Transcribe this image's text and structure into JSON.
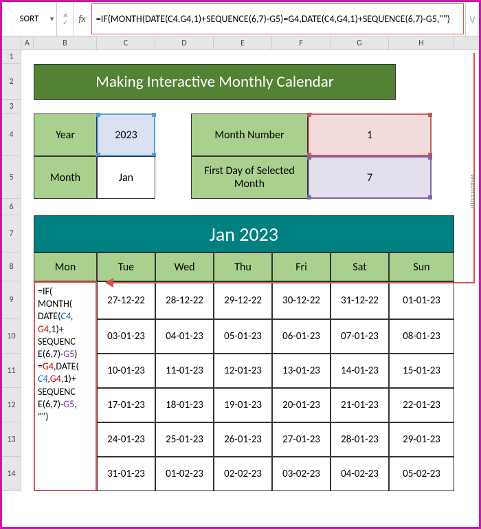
{
  "name_box": "SORT",
  "formula": "=IF(MONTH(DATE(C4,G4,1)+SEQUENCE(6,7)-G5)=G4,DATE(C4,G4,1)+SEQUENCE(6,7)-G5,\"\")",
  "columns": [
    "A",
    "B",
    "C",
    "D",
    "E",
    "F",
    "G",
    "H"
  ],
  "rows": [
    "1",
    "2",
    "3",
    "4",
    "5",
    "6",
    "7",
    "8",
    "9",
    "10",
    "11",
    "12",
    "13",
    "14"
  ],
  "title": "Making Interactive Monthly Calendar",
  "params": {
    "year_label": "Year",
    "year_value": "2023",
    "month_label": "Month",
    "month_value": "Jan",
    "month_num_label": "Month Number",
    "month_num_value": "1",
    "first_day_label": "First Day of Selected Month",
    "first_day_value": "7"
  },
  "calendar": {
    "title": "Jan 2023",
    "days": [
      "Mon",
      "Tue",
      "Wed",
      "Thu",
      "Fri",
      "Sat",
      "Sun"
    ],
    "formula_parts": {
      "p1": "=IF(",
      "p2": "MONTH(",
      "p3a": "DATE(",
      "p3b": "C4",
      "p3c": ",",
      "p4a": "G4",
      "p4b": ",1)+",
      "p5": "SEQUENC",
      "p6a": "E(6,7)-",
      "p6b": "G5",
      "p6c": ")",
      "p7a": "=",
      "p7b": "G4",
      "p7c": ",DATE(",
      "p8a": "C4",
      "p8b": ",",
      "p8c": "G4",
      "p8d": ",1)+",
      "p9": "SEQUENC",
      "p10a": "E(6,7)-",
      "p10b": "G5",
      "p10c": ",",
      "p11": "\"\")"
    },
    "rows": [
      [
        "27-12-22",
        "28-12-22",
        "29-12-22",
        "30-12-22",
        "31-12-22",
        "01-01-23"
      ],
      [
        "03-01-23",
        "04-01-23",
        "05-01-23",
        "06-01-23",
        "07-01-23",
        "08-01-23"
      ],
      [
        "10-01-23",
        "11-01-23",
        "12-01-23",
        "13-01-23",
        "14-01-23",
        "15-01-23"
      ],
      [
        "17-01-23",
        "18-01-23",
        "19-01-23",
        "20-01-23",
        "21-01-23",
        "22-01-23"
      ],
      [
        "24-01-23",
        "25-01-23",
        "26-01-23",
        "27-01-23",
        "28-01-23",
        "29-01-23"
      ],
      [
        "31-01-23",
        "01-02-23",
        "02-02-23",
        "03-02-23",
        "04-02-23",
        "05-02-23"
      ]
    ]
  },
  "credit": "wsxdn.com"
}
